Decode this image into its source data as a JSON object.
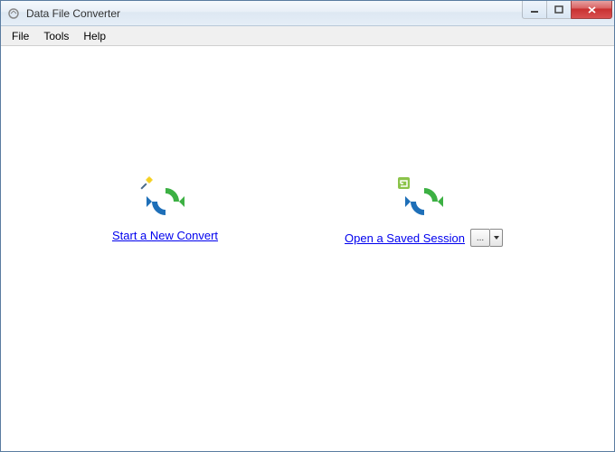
{
  "window": {
    "title": "Data File Converter"
  },
  "menu": {
    "file": "File",
    "tools": "Tools",
    "help": "Help"
  },
  "actions": {
    "new_convert": "Start a New Convert",
    "open_session": "Open a Saved Session",
    "more_btn": "..."
  }
}
